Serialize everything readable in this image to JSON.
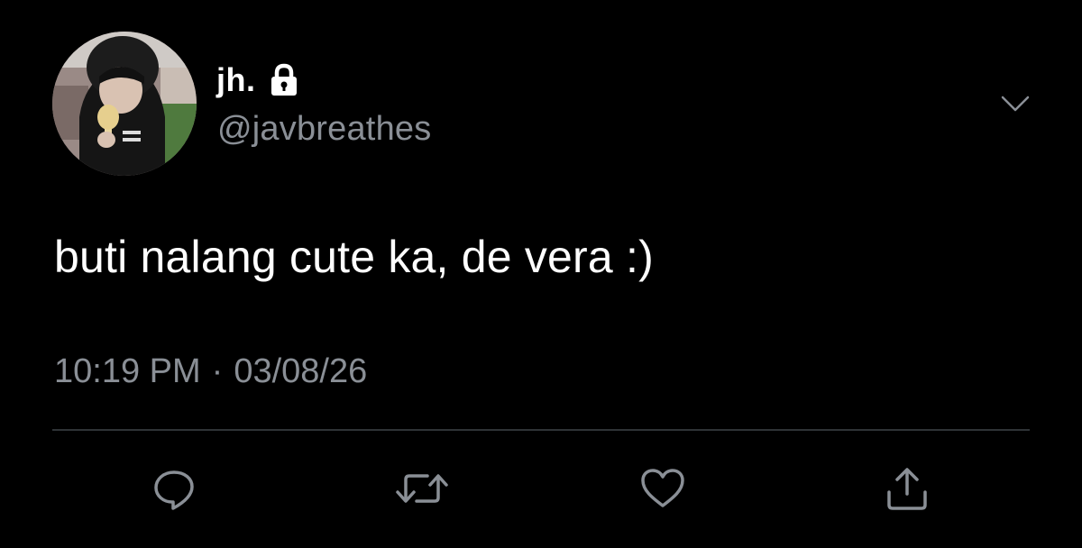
{
  "tweet": {
    "display_name": "jh.",
    "handle": "@javbreathes",
    "text": "buti nalang cute ka, de vera :)",
    "time": "10:19 PM",
    "separator": "·",
    "date": "03/08/26",
    "protected_icon": "lock-icon",
    "menu_icon": "chevron-down-icon"
  },
  "actions": [
    {
      "name": "reply",
      "icon": "reply-icon"
    },
    {
      "name": "retweet",
      "icon": "retweet-icon"
    },
    {
      "name": "like",
      "icon": "heart-icon"
    },
    {
      "name": "share",
      "icon": "share-icon"
    }
  ],
  "colors": {
    "background": "#000000",
    "primary_text": "#ffffff",
    "secondary_text": "#8a8f96",
    "divider": "#2f3336",
    "icon": "#8a8f96"
  }
}
